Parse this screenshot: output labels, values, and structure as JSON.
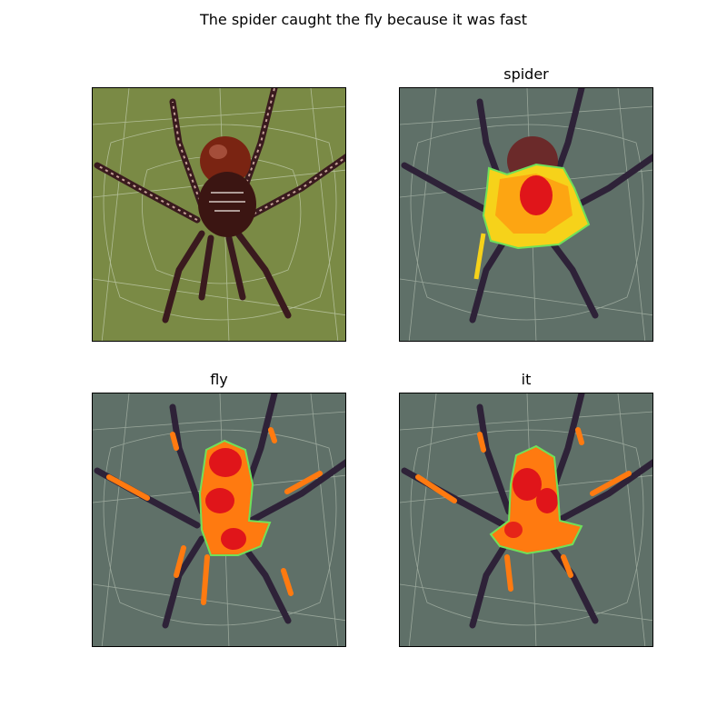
{
  "figure": {
    "title": "The spider caught the fly because it was fast"
  },
  "panels": [
    {
      "title": "",
      "kind": "original",
      "background": "#7a8a45"
    },
    {
      "title": "spider",
      "kind": "attention-overlay",
      "background": "#5f7068"
    },
    {
      "title": "fly",
      "kind": "attention-overlay",
      "background": "#5f7068"
    },
    {
      "title": "it",
      "kind": "attention-overlay",
      "background": "#5f7068"
    }
  ],
  "colors": {
    "heat_hot": "#e0151a",
    "heat_warm": "#ff7a10",
    "heat_mid": "#f6d21a",
    "heat_cool": "#6fe05a",
    "spider_body": "#5a1a10",
    "spider_leg": "#3a1a1e",
    "web": "#dfe8d8"
  }
}
